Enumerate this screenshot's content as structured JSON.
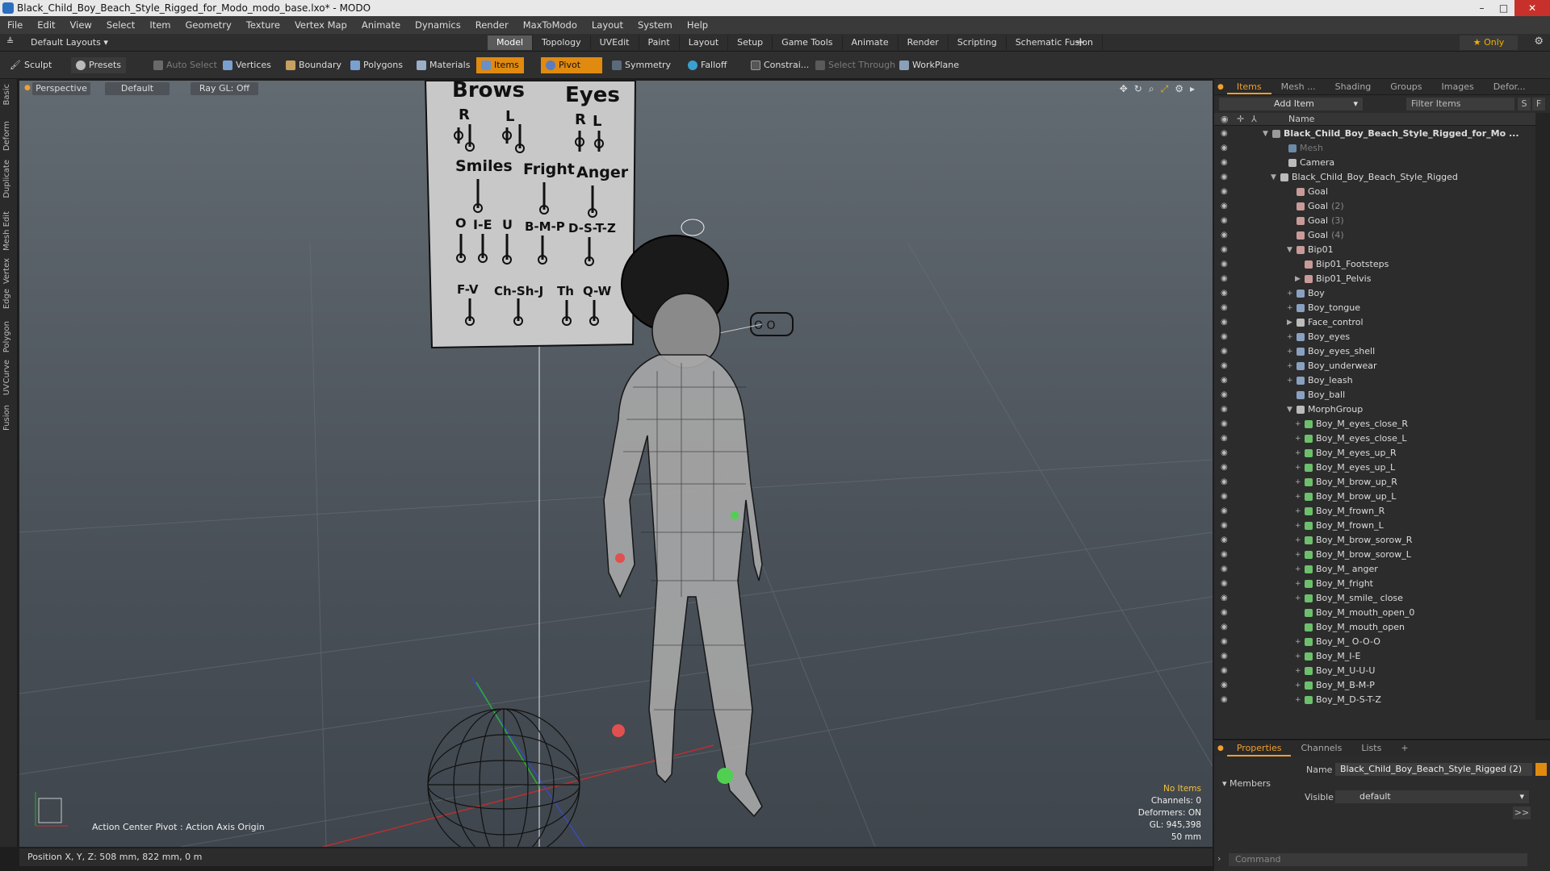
{
  "window": {
    "title": "Black_Child_Boy_Beach_Style_Rigged_for_Modo_modo_base.lxo* - MODO",
    "minimize": "–",
    "maximize": "□",
    "close": "✕"
  },
  "menu": [
    "File",
    "Edit",
    "View",
    "Select",
    "Item",
    "Geometry",
    "Texture",
    "Vertex Map",
    "Animate",
    "Dynamics",
    "Render",
    "MaxToModo",
    "Layout",
    "System",
    "Help"
  ],
  "layout_bar": {
    "dropdown": "Default Layouts",
    "tabs": [
      {
        "label": "Model",
        "active": true
      },
      {
        "label": "Topology",
        "active": false
      },
      {
        "label": "UVEdit",
        "active": false
      },
      {
        "label": "Paint",
        "active": false
      },
      {
        "label": "Layout",
        "active": false
      },
      {
        "label": "Setup",
        "active": false
      },
      {
        "label": "Game Tools",
        "active": false
      },
      {
        "label": "Animate",
        "active": false
      },
      {
        "label": "Render",
        "active": false
      },
      {
        "label": "Scripting",
        "active": false
      },
      {
        "label": "Schematic Fusion",
        "active": false
      }
    ],
    "add": "+",
    "only": "Only"
  },
  "toolbar": {
    "sculpt": "Sculpt",
    "presets": "Presets",
    "auto_select": "Auto Select",
    "vertices": "Vertices",
    "boundary": "Boundary",
    "polygons": "Polygons",
    "materials": "Materials",
    "items": "Items",
    "pivot": "Pivot",
    "symmetry": "Symmetry",
    "falloff": "Falloff",
    "constraints": "Constrai...",
    "select_through": "Select Through",
    "workplane": "WorkPlane"
  },
  "left_tabs": [
    "Basic",
    "Deform",
    "Duplicate",
    "Mesh Edit",
    "Vertex",
    "Edge",
    "Polygon",
    "Curve",
    "UV",
    "Fusion"
  ],
  "viewport": {
    "view": "Perspective",
    "shading": "Default",
    "raygl": "Ray GL: Off",
    "action_center": "Action Center Pivot : Action Axis Origin",
    "hud": {
      "no_items": "No Items",
      "channels": "Channels: 0",
      "deformers": "Deformers: ON",
      "gl": "GL: 945,398",
      "focal": "50 mm"
    },
    "face_board": {
      "brows": "Brows",
      "eyes": "Eyes",
      "r1": "R",
      "l1": "L",
      "r2": "R",
      "l2": "L",
      "smiles": "Smiles",
      "fright": "Fright",
      "anger": "Anger",
      "o": "O",
      "ie": "I-E",
      "u": "U",
      "bmp": "B-M-P",
      "dstz": "D-S-T-Z",
      "fv": "F-V",
      "chshj": "Ch-Sh-J",
      "th": "Th",
      "qw": "Q-W"
    },
    "eye_ctrl": "O  O"
  },
  "status": {
    "position": "Position X, Y, Z:   508 mm, 822 mm, 0 m"
  },
  "right_panel": {
    "tabs": [
      {
        "label": "Items",
        "active": true
      },
      {
        "label": "Mesh ...",
        "active": false
      },
      {
        "label": "Shading",
        "active": false
      },
      {
        "label": "Groups",
        "active": false
      },
      {
        "label": "Images",
        "active": false
      },
      {
        "label": "Defor...",
        "active": false
      }
    ],
    "add_item": "Add Item",
    "filter": "Filter Items",
    "s_btn": "S",
    "f_btn": "F",
    "name_col": "Name",
    "tree": [
      {
        "label": "Black_Child_Boy_Beach_Style_Rigged_for_Mo ...",
        "indent": 0,
        "exp": "▼",
        "color": "#9a9a9a",
        "bold": true,
        "suffix": ""
      },
      {
        "label": "Mesh",
        "indent": 2,
        "exp": "",
        "color": "#6a8aa8",
        "dim": true,
        "suffix": ""
      },
      {
        "label": "Camera",
        "indent": 2,
        "exp": "",
        "color": "#bbbbbb",
        "suffix": ""
      },
      {
        "label": "Black_Child_Boy_Beach_Style_Rigged",
        "indent": 1,
        "exp": "▼",
        "color": "#bbbbbb",
        "suffix": ""
      },
      {
        "label": "Goal",
        "indent": 3,
        "exp": "",
        "color": "#c89a9a",
        "suffix": ""
      },
      {
        "label": "Goal",
        "indent": 3,
        "exp": "",
        "color": "#c89a9a",
        "suffix": "(2)"
      },
      {
        "label": "Goal",
        "indent": 3,
        "exp": "",
        "color": "#c89a9a",
        "suffix": "(3)"
      },
      {
        "label": "Goal",
        "indent": 3,
        "exp": "",
        "color": "#c89a9a",
        "suffix": "(4)"
      },
      {
        "label": "Bip01",
        "indent": 3,
        "exp": "▼",
        "color": "#c89a9a",
        "suffix": ""
      },
      {
        "label": "Bip01_Footsteps",
        "indent": 4,
        "exp": "",
        "color": "#c89a9a",
        "suffix": ""
      },
      {
        "label": "Bip01_Pelvis",
        "indent": 4,
        "exp": "▶",
        "color": "#c89a9a",
        "suffix": ""
      },
      {
        "label": "Boy",
        "indent": 3,
        "exp": "+",
        "color": "#8aa0c0",
        "suffix": ""
      },
      {
        "label": "Boy_tongue",
        "indent": 3,
        "exp": "+",
        "color": "#8aa0c0",
        "suffix": ""
      },
      {
        "label": "Face_control",
        "indent": 3,
        "exp": "▶",
        "color": "#bbbbbb",
        "suffix": ""
      },
      {
        "label": "Boy_eyes",
        "indent": 3,
        "exp": "+",
        "color": "#8aa0c0",
        "suffix": ""
      },
      {
        "label": "Boy_eyes_shell",
        "indent": 3,
        "exp": "+",
        "color": "#8aa0c0",
        "suffix": ""
      },
      {
        "label": "Boy_underwear",
        "indent": 3,
        "exp": "+",
        "color": "#8aa0c0",
        "suffix": ""
      },
      {
        "label": "Boy_leash",
        "indent": 3,
        "exp": "+",
        "color": "#8aa0c0",
        "suffix": ""
      },
      {
        "label": "Boy_ball",
        "indent": 3,
        "exp": "",
        "color": "#8aa0c0",
        "suffix": ""
      },
      {
        "label": "MorphGroup",
        "indent": 3,
        "exp": "▼",
        "color": "#bbbbbb",
        "suffix": ""
      },
      {
        "label": "Boy_M_eyes_close_R",
        "indent": 4,
        "exp": "+",
        "color": "#6cc06c",
        "suffix": ""
      },
      {
        "label": "Boy_M_eyes_close_L",
        "indent": 4,
        "exp": "+",
        "color": "#6cc06c",
        "suffix": ""
      },
      {
        "label": "Boy_M_eyes_up_R",
        "indent": 4,
        "exp": "+",
        "color": "#6cc06c",
        "suffix": ""
      },
      {
        "label": "Boy_M_eyes_up_L",
        "indent": 4,
        "exp": "+",
        "color": "#6cc06c",
        "suffix": ""
      },
      {
        "label": "Boy_M_brow_up_R",
        "indent": 4,
        "exp": "+",
        "color": "#6cc06c",
        "suffix": ""
      },
      {
        "label": "Boy_M_brow_up_L",
        "indent": 4,
        "exp": "+",
        "color": "#6cc06c",
        "suffix": ""
      },
      {
        "label": "Boy_M_frown_R",
        "indent": 4,
        "exp": "+",
        "color": "#6cc06c",
        "suffix": ""
      },
      {
        "label": "Boy_M_frown_L",
        "indent": 4,
        "exp": "+",
        "color": "#6cc06c",
        "suffix": ""
      },
      {
        "label": "Boy_M_brow_sorow_R",
        "indent": 4,
        "exp": "+",
        "color": "#6cc06c",
        "suffix": ""
      },
      {
        "label": "Boy_M_brow_sorow_L",
        "indent": 4,
        "exp": "+",
        "color": "#6cc06c",
        "suffix": ""
      },
      {
        "label": "Boy_M_ anger",
        "indent": 4,
        "exp": "+",
        "color": "#6cc06c",
        "suffix": ""
      },
      {
        "label": "Boy_M_fright",
        "indent": 4,
        "exp": "+",
        "color": "#6cc06c",
        "suffix": ""
      },
      {
        "label": "Boy_M_smile_ close",
        "indent": 4,
        "exp": "+",
        "color": "#6cc06c",
        "suffix": ""
      },
      {
        "label": "Boy_M_mouth_open_0",
        "indent": 4,
        "exp": "",
        "color": "#6cc06c",
        "suffix": ""
      },
      {
        "label": "Boy_M_mouth_open",
        "indent": 4,
        "exp": "",
        "color": "#6cc06c",
        "suffix": ""
      },
      {
        "label": "Boy_M_ O-O-O",
        "indent": 4,
        "exp": "+",
        "color": "#6cc06c",
        "suffix": ""
      },
      {
        "label": "Boy_M_I-E",
        "indent": 4,
        "exp": "+",
        "color": "#6cc06c",
        "suffix": ""
      },
      {
        "label": "Boy_M_U-U-U",
        "indent": 4,
        "exp": "+",
        "color": "#6cc06c",
        "suffix": ""
      },
      {
        "label": "Boy_M_B-M-P",
        "indent": 4,
        "exp": "+",
        "color": "#6cc06c",
        "suffix": ""
      },
      {
        "label": "Boy_M_D-S-T-Z",
        "indent": 4,
        "exp": "+",
        "color": "#6cc06c",
        "suffix": ""
      }
    ]
  },
  "properties": {
    "tabs": [
      {
        "label": "Properties",
        "active": true
      },
      {
        "label": "Channels",
        "active": false
      },
      {
        "label": "Lists",
        "active": false
      }
    ],
    "add": "+",
    "name_label": "Name",
    "name_value": "Black_Child_Boy_Beach_Style_Rigged (2)",
    "members": "Members",
    "visible_label": "Visible",
    "visible_value": "default",
    "more": ">>",
    "command_placeholder": "Command"
  },
  "colors": {
    "accent": "#f0a030",
    "pivot_active": "#e08a10"
  }
}
